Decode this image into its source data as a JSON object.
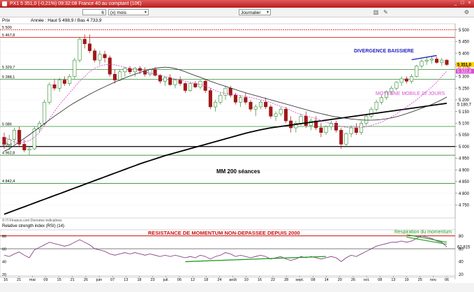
{
  "window": {
    "title": "PX1  5 351,0 (-0,21%)  09:32:08 France 40 au comptant (10€)",
    "buttons": [
      "_",
      "□",
      "×"
    ]
  },
  "toolbar": {
    "period_value": "6",
    "period_unit": "(x) mois",
    "interval": "Journalier",
    "icons": [
      "chart-type-icon",
      "draw-tool-icon",
      "settings-icon"
    ]
  },
  "header": {
    "label": "Prix",
    "info": "Année : Haut 5 498,9 / Bas 4 733,9"
  },
  "annotations": {
    "divergence": "DIVERGENCE BAISSIERE",
    "ma20": "MOYENNE MOBILE 20 JOURS",
    "mm200": "MM 200 séances",
    "rsi_resistance": "RESISTANCE DE MOMENTUM NON-DEPASSEE DEPUIS 2000",
    "rsi_breath": "Respiration du momentum",
    "copyright": "© IT-Finance.com Données indicatives",
    "rsi_title": "Relative strength index (RSI) (14)"
  },
  "colors": {
    "candle_up": "#2e8b2e",
    "candle_down": "#a01818",
    "ma20": "#d94fd1",
    "ma50": "#222222",
    "mm200": "#000000",
    "price_tag": "#ffd400",
    "ma20_tag": "#d94fd1",
    "rsi_line": "#7a2a7a",
    "trend_green": "#1f9e1f",
    "divergence_blue": "#1f1fbf",
    "resistance_red": "#cc1111",
    "hline_red": "#e02020",
    "hline_green": "#2e8b2e",
    "hline_black": "#000000"
  },
  "chart_data": [
    {
      "type": "candlestick",
      "title": "",
      "ylim": [
        4700,
        5520
      ],
      "y_ticks": [
        5500,
        5450,
        5400,
        5350,
        5300,
        5250,
        5200,
        5150,
        5100,
        5050,
        5000,
        4950,
        4900,
        4850,
        4800,
        4750
      ],
      "y_tick_labels": [
        "5 500",
        "5 450",
        "5 400",
        "5 350",
        "5 300",
        "5 250",
        "5 200",
        "5 150",
        "5 100",
        "5 050",
        "5 000",
        "4 950",
        "4 900",
        "4 850",
        "4 800",
        "4 750"
      ],
      "x_tick_labels": [
        "16",
        "21",
        "mai",
        "09",
        "15",
        "21",
        "26",
        "juin",
        "07",
        "13",
        "18",
        "23",
        "juil.",
        "06",
        "12",
        "18",
        "24",
        "août",
        "10",
        "16",
        "22",
        "28",
        "sept.",
        "08",
        "14",
        "20",
        "26",
        "oct.",
        "08",
        "13",
        "19",
        "25",
        "nov.",
        "06"
      ],
      "level_labels": [
        {
          "value": 5500,
          "label": "5 500",
          "color": "#e02020"
        },
        {
          "value": 5467.8,
          "label": "5 467,8",
          "color": "#e02020"
        },
        {
          "value": 5329.7,
          "label": "5 329,7",
          "color": "#2e8b2e"
        },
        {
          "value": 5288.1,
          "label": "5 288,1",
          "color": "#2e8b2e"
        },
        {
          "value": 5086,
          "label": "5 086",
          "color": "#2e8b2e"
        },
        {
          "value": 5000,
          "label": "5 000",
          "color": "#000000"
        },
        {
          "value": 4962.8,
          "label": "4 962,8",
          "color": "#2e8b2e"
        },
        {
          "value": 4842.4,
          "label": "4 842,4",
          "color": "#2e8b2e"
        }
      ],
      "right_labels": [
        {
          "value": 5351,
          "label": "5 351,0",
          "style": "price"
        },
        {
          "value": 5337,
          "label": "-0,21%",
          "style": "red"
        },
        {
          "value": 5322.8,
          "label": "5 322,8",
          "style": "ma"
        },
        {
          "value": 5180.7,
          "label": "5 180,7",
          "style": "plain"
        }
      ],
      "candles": [
        [
          5040,
          5060,
          4990,
          5010
        ],
        [
          5010,
          5050,
          4985,
          5030
        ],
        [
          5030,
          5080,
          5010,
          5070
        ],
        [
          5070,
          5085,
          5000,
          5010
        ],
        [
          5010,
          5030,
          4975,
          4985
        ],
        [
          4985,
          5000,
          4962.8,
          4990
        ],
        [
          4990,
          5085,
          4985,
          5075
        ],
        [
          5075,
          5110,
          5060,
          5100
        ],
        [
          5100,
          5200,
          5090,
          5190
        ],
        [
          5190,
          5275,
          5180,
          5265
        ],
        [
          5265,
          5290,
          5240,
          5250
        ],
        [
          5250,
          5295,
          5235,
          5285
        ],
        [
          5285,
          5300,
          5260,
          5270
        ],
        [
          5270,
          5310,
          5260,
          5300
        ],
        [
          5300,
          5380,
          5290,
          5370
        ],
        [
          5370,
          5470,
          5360,
          5460
        ],
        [
          5460,
          5480,
          5420,
          5440
        ],
        [
          5440,
          5480,
          5400,
          5410
        ],
        [
          5410,
          5420,
          5360,
          5370
        ],
        [
          5370,
          5410,
          5350,
          5395
        ],
        [
          5395,
          5410,
          5360,
          5380
        ],
        [
          5380,
          5390,
          5300,
          5310
        ],
        [
          5310,
          5330,
          5270,
          5285
        ],
        [
          5285,
          5330,
          5280,
          5320
        ],
        [
          5320,
          5340,
          5300,
          5335
        ],
        [
          5335,
          5345,
          5310,
          5320
        ],
        [
          5320,
          5340,
          5300,
          5335
        ],
        [
          5335,
          5345,
          5310,
          5325
        ],
        [
          5325,
          5340,
          5300,
          5310
        ],
        [
          5310,
          5335,
          5300,
          5330
        ],
        [
          5330,
          5340,
          5300,
          5305
        ],
        [
          5305,
          5310,
          5270,
          5280
        ],
        [
          5280,
          5300,
          5260,
          5295
        ],
        [
          5295,
          5310,
          5260,
          5265
        ],
        [
          5265,
          5290,
          5250,
          5285
        ],
        [
          5285,
          5300,
          5260,
          5270
        ],
        [
          5270,
          5275,
          5230,
          5240
        ],
        [
          5240,
          5275,
          5235,
          5270
        ],
        [
          5270,
          5280,
          5250,
          5255
        ],
        [
          5255,
          5285,
          5245,
          5280
        ],
        [
          5280,
          5290,
          5230,
          5240
        ],
        [
          5240,
          5250,
          5160,
          5170
        ],
        [
          5170,
          5200,
          5150,
          5190
        ],
        [
          5190,
          5230,
          5180,
          5220
        ],
        [
          5220,
          5260,
          5200,
          5250
        ],
        [
          5250,
          5260,
          5210,
          5220
        ],
        [
          5220,
          5230,
          5180,
          5190
        ],
        [
          5190,
          5220,
          5170,
          5210
        ],
        [
          5210,
          5230,
          5180,
          5190
        ],
        [
          5190,
          5200,
          5150,
          5160
        ],
        [
          5160,
          5180,
          5130,
          5170
        ],
        [
          5170,
          5200,
          5160,
          5190
        ],
        [
          5190,
          5210,
          5160,
          5170
        ],
        [
          5170,
          5180,
          5120,
          5130
        ],
        [
          5130,
          5150,
          5110,
          5140
        ],
        [
          5140,
          5170,
          5130,
          5160
        ],
        [
          5160,
          5170,
          5100,
          5110
        ],
        [
          5110,
          5130,
          5060,
          5080
        ],
        [
          5080,
          5110,
          5060,
          5100
        ],
        [
          5100,
          5140,
          5090,
          5130
        ],
        [
          5130,
          5150,
          5080,
          5090
        ],
        [
          5090,
          5120,
          5070,
          5110
        ],
        [
          5110,
          5130,
          5070,
          5080
        ],
        [
          5080,
          5100,
          5040,
          5060
        ],
        [
          5060,
          5090,
          5050,
          5085
        ],
        [
          5085,
          5110,
          5070,
          5100
        ],
        [
          5100,
          5110,
          5060,
          5070
        ],
        [
          5070,
          5080,
          4990,
          5010
        ],
        [
          5010,
          5060,
          5000,
          5055
        ],
        [
          5055,
          5090,
          5040,
          5080
        ],
        [
          5080,
          5100,
          5050,
          5060
        ],
        [
          5060,
          5110,
          5050,
          5100
        ],
        [
          5100,
          5140,
          5090,
          5130
        ],
        [
          5130,
          5170,
          5120,
          5160
        ],
        [
          5160,
          5200,
          5150,
          5190
        ],
        [
          5190,
          5220,
          5180,
          5210
        ],
        [
          5210,
          5240,
          5200,
          5235
        ],
        [
          5235,
          5260,
          5220,
          5250
        ],
        [
          5250,
          5280,
          5240,
          5275
        ],
        [
          5275,
          5300,
          5260,
          5290
        ],
        [
          5290,
          5300,
          5270,
          5280
        ],
        [
          5280,
          5310,
          5270,
          5300
        ],
        [
          5300,
          5350,
          5295,
          5345
        ],
        [
          5345,
          5375,
          5335,
          5365
        ],
        [
          5365,
          5385,
          5350,
          5370
        ],
        [
          5370,
          5385,
          5355,
          5375
        ],
        [
          5375,
          5385,
          5355,
          5360
        ],
        [
          5360,
          5380,
          5345,
          5370
        ],
        [
          5370,
          5375,
          5345,
          5351
        ]
      ],
      "ma20": [
        5040,
        5030,
        5020,
        5015,
        5020,
        5025,
        5040,
        5060,
        5090,
        5120,
        5150,
        5180,
        5205,
        5230,
        5255,
        5280,
        5300,
        5320,
        5335,
        5345,
        5350,
        5352,
        5350,
        5345,
        5340,
        5335,
        5330,
        5325,
        5320,
        5315,
        5310,
        5305,
        5300,
        5295,
        5290,
        5285,
        5280,
        5275,
        5270,
        5265,
        5260,
        5250,
        5240,
        5232,
        5228,
        5225,
        5222,
        5218,
        5214,
        5210,
        5205,
        5200,
        5195,
        5188,
        5180,
        5172,
        5165,
        5155,
        5145,
        5138,
        5132,
        5126,
        5120,
        5112,
        5104,
        5098,
        5092,
        5086,
        5082,
        5080,
        5080,
        5082,
        5085,
        5090,
        5097,
        5105,
        5115,
        5127,
        5140,
        5155,
        5170,
        5185,
        5200,
        5218,
        5236,
        5255,
        5275,
        5300,
        5322.8
      ],
      "ma50": [
        4980,
        4990,
        5005,
        5020,
        5035,
        5050,
        5066,
        5082,
        5098,
        5114,
        5130,
        5145,
        5160,
        5175,
        5188,
        5200,
        5212,
        5224,
        5235,
        5246,
        5256,
        5266,
        5276,
        5285,
        5294,
        5302,
        5310,
        5317,
        5324,
        5330,
        5335,
        5338,
        5340,
        5338,
        5334,
        5328,
        5320,
        5312,
        5304,
        5296,
        5288,
        5280,
        5272,
        5265,
        5258,
        5251,
        5244,
        5237,
        5230,
        5224,
        5218,
        5212,
        5206,
        5200,
        5194,
        5188,
        5182,
        5176,
        5170,
        5164,
        5158,
        5152,
        5146,
        5141,
        5136,
        5131,
        5127,
        5124,
        5121,
        5118,
        5116,
        5114,
        5113,
        5113,
        5114,
        5116,
        5119,
        5123,
        5128,
        5134,
        5141,
        5148,
        5156,
        5164,
        5172,
        5180,
        5190,
        5200,
        5212
      ],
      "mm200": [
        4710,
        4718,
        4726,
        4734,
        4742,
        4750,
        4758,
        4766,
        4774,
        4782,
        4790,
        4798,
        4806,
        4814,
        4822,
        4830,
        4838,
        4846,
        4854,
        4862,
        4870,
        4878,
        4886,
        4894,
        4902,
        4910,
        4918,
        4926,
        4933,
        4940,
        4947,
        4954,
        4961,
        4967,
        4973,
        4979,
        4985,
        4991,
        4997,
        5003,
        5009,
        5015,
        5021,
        5027,
        5033,
        5039,
        5045,
        5051,
        5057,
        5062,
        5067,
        5072,
        5076,
        5080,
        5083,
        5086,
        5089,
        5092,
        5095,
        5098,
        5101,
        5104,
        5107,
        5110,
        5113,
        5116,
        5119,
        5122,
        5125,
        5128,
        5131,
        5134,
        5137,
        5140,
        5143,
        5146,
        5149,
        5152,
        5155,
        5158,
        5161,
        5164,
        5167,
        5170,
        5173,
        5176,
        5179,
        5182,
        5185
      ]
    },
    {
      "type": "line",
      "title": "Relative strength index (RSI) (14)",
      "ylim": [
        20,
        85
      ],
      "y_ticks": [
        80,
        60,
        40,
        20
      ],
      "y_tick_labels": [
        "80",
        "60",
        "40",
        "20"
      ],
      "last_value": {
        "value": 62.815,
        "label": "62,815"
      },
      "levels": [
        80,
        60
      ],
      "values": [
        50,
        48,
        52,
        55,
        50,
        46,
        58,
        62,
        66,
        70,
        68,
        66,
        64,
        66,
        70,
        74,
        70,
        66,
        60,
        58,
        56,
        52,
        50,
        52,
        54,
        52,
        54,
        52,
        50,
        52,
        50,
        48,
        50,
        48,
        50,
        48,
        46,
        48,
        46,
        50,
        48,
        44,
        48,
        50,
        54,
        52,
        48,
        50,
        48,
        46,
        48,
        50,
        48,
        44,
        46,
        48,
        44,
        42,
        44,
        48,
        46,
        48,
        46,
        44,
        46,
        48,
        46,
        40,
        46,
        50,
        48,
        52,
        56,
        60,
        64,
        66,
        68,
        70,
        70,
        72,
        70,
        72,
        76,
        80,
        78,
        76,
        72,
        70,
        62.815
      ]
    }
  ]
}
